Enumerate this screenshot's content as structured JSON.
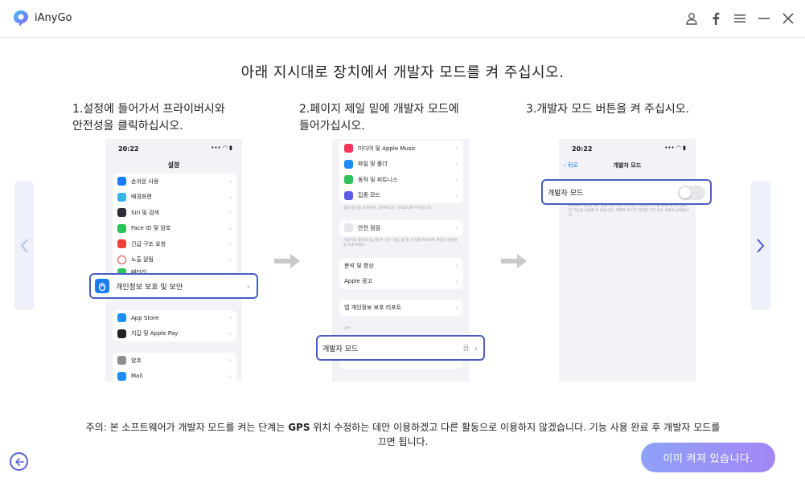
{
  "app": {
    "name": "iAnyGo"
  },
  "titlebar": {
    "icons": [
      "user-icon",
      "facebook-icon",
      "menu-icon",
      "minimize-icon",
      "close-icon"
    ]
  },
  "title": "아래 지시대로 장치에서 개발자 모드를 켜 주십시오.",
  "steps": [
    {
      "line1": "1.설정에 들어가서 프라이버시와",
      "line2": "안전성을 클릭하십시오."
    },
    {
      "line1": "2.페이지 제일 밑에 개발자 모드에",
      "line2": "들어가십시오."
    },
    {
      "line1": "3.개발자 모드 버튼을 켜 주십시오.",
      "line2": ""
    }
  ],
  "phone1": {
    "time": "20:22",
    "header": "설정",
    "group1": [
      "손쉬운 사용",
      "배경화면",
      "Siri 및 검색",
      "Face ID 및 암호",
      "긴급 구조 요청",
      "노출 알림",
      "배터리"
    ],
    "highlight": "개인정보 보호 및 보안",
    "group2": [
      "App Store",
      "지갑 및 Apple Pay"
    ],
    "group3": [
      "암호",
      "Mail"
    ]
  },
  "phone2": {
    "group1": [
      "미디어 및 Apple Music",
      "파일 및 폴더",
      "동작 및 피트니스",
      "집중 모드"
    ],
    "note1": "앱이 접근을 요청하면, 상단에 있는 카테고리에 추가됩니다.",
    "safety": "안전 점검",
    "note2": "사용자의 정보에 접근할 수 있는 사람, 앱 및 기기를 파악하여 개인의 안전성을 보호하세요.",
    "group2": [
      "분석 및 향상",
      "Apple 광고"
    ],
    "report": "앱 개인정보 보호 리포트",
    "section": "보안",
    "highlight": "개발자 모드",
    "highlight_value": "끔"
  },
  "phone3": {
    "time": "20:22",
    "back": "뒤로",
    "header": "개발자 모드",
    "highlight": "개발자 모드",
    "note": "iPhone 개발에 대한 앱을 개발하는 경우에는, 개발자 모드를 통해 개발에 필요한 기능을 사용할 수 있습니다. 개발자 모드가 켜지면 기기 보안 수준이 낮아집니다."
  },
  "notice": {
    "line1a": "주의: 본 소프트웨어가 개발자 모드를 켜는 단계는 ",
    "line1b": "GPS",
    "line1c": " 위치 수정하는 데만 이용하겠고 다른 활동으로 이용하지 않겠습니다. 기능 사용 완료 후 개발자 모드를",
    "line2": "끄면 됩니다."
  },
  "primary_button": "이미 켜져 있습니다.",
  "colors": {
    "accent": "#4b5cc4",
    "button_start": "#8ea1f7",
    "button_end": "#a387f5",
    "nav_panel": "#eef0fb"
  }
}
